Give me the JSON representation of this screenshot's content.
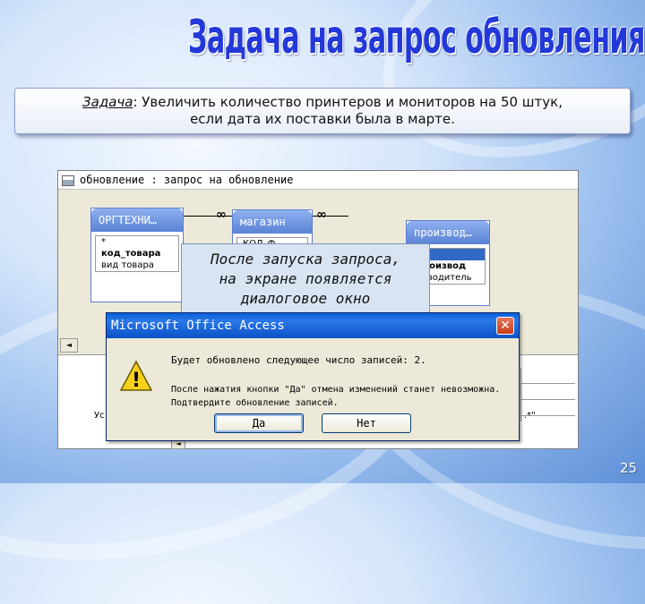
{
  "slide": {
    "title": "Задача на запрос обновления",
    "page_number": "25"
  },
  "task": {
    "label": "Задача",
    "line1_rest": ": Увеличить количество принтеров и мониторов на 50 штук,",
    "line2": "если дата их поставки была в марте."
  },
  "access_window": {
    "title": "обновление : запрос на обновление",
    "tables": [
      {
        "name": "ОРГТЕХНИ…",
        "fields": [
          "*",
          "код_товара",
          "вид товара"
        ]
      },
      {
        "name": "магазин",
        "fields": [
          "КОД_Ф",
          "",
          ""
        ]
      },
      {
        "name": "производ…",
        "fields": [
          "",
          "производ",
          "изводитель"
        ]
      }
    ],
    "link_symbol_1": "∞",
    "link_symbol_2": "∞",
    "grid_label": "Ус",
    "grid_right_value": ".*\"",
    "scroll_left": "◄",
    "scroll_left2": "◄"
  },
  "callout": {
    "line1": "После запуска запроса,",
    "line2": "на экране появляется",
    "line3": "диалоговое окно"
  },
  "dialog": {
    "title": "Microsoft Office Access",
    "close_symbol": "✕",
    "warning_symbol": "!",
    "message1": "Будет обновлено следующее число записей: 2.",
    "message2_line1": "После нажатия кнопки \"Да\" отмена изменений станет невозможна.",
    "message2_line2": "Подтвердите обновление записей.",
    "yes_label": "Да",
    "no_label": "Нет"
  }
}
